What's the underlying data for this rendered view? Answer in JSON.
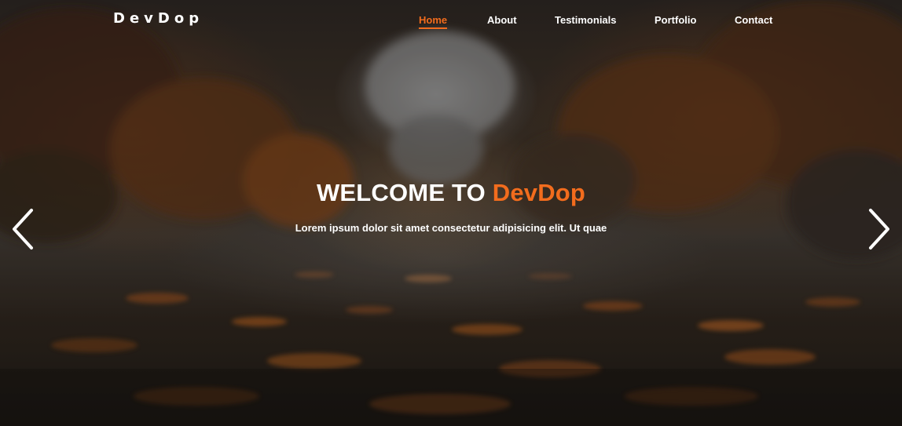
{
  "brand": {
    "name": "DevDop"
  },
  "nav": {
    "items": [
      {
        "label": "Home",
        "active": true
      },
      {
        "label": "About",
        "active": false
      },
      {
        "label": "Testimonials",
        "active": false
      },
      {
        "label": "Portfolio",
        "active": false
      },
      {
        "label": "Contact",
        "active": false
      }
    ]
  },
  "hero": {
    "headline_prefix": "WELCOME TO ",
    "headline_accent": "DevDop",
    "subtitle": "Lorem ipsum dolor sit amet consectetur adipisicing elit. Ut quae"
  },
  "carousel": {
    "prev_icon": "chevron-left-icon",
    "next_icon": "chevron-right-icon"
  },
  "colors": {
    "accent": "#f26c1d",
    "text": "#ffffff"
  }
}
